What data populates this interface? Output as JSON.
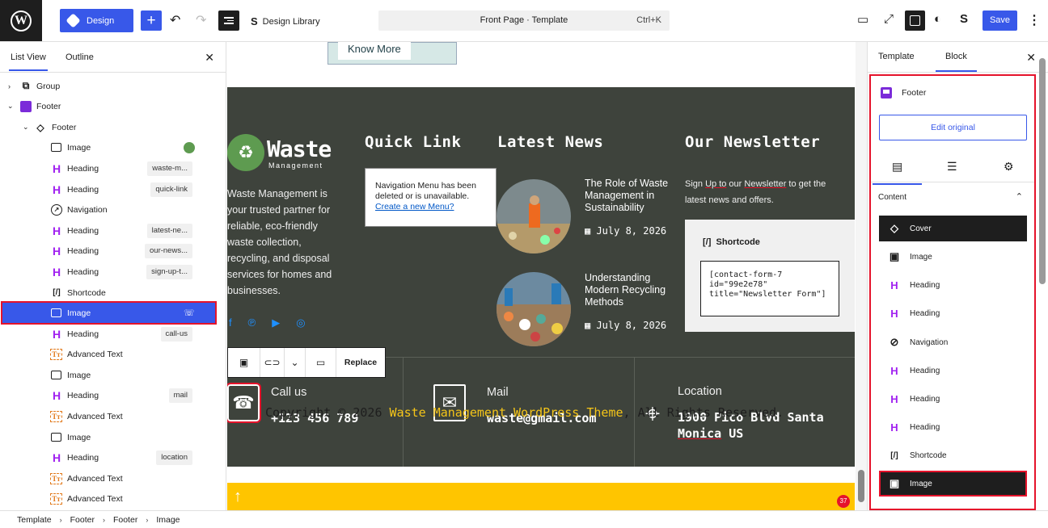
{
  "topbar": {
    "design_label": "Design",
    "design_library_label": "Design Library",
    "command_title": "Front Page · Template",
    "command_shortcut": "Ctrl+K",
    "save_label": "Save"
  },
  "list_view": {
    "tab_list": "List View",
    "tab_outline": "Outline",
    "rows": [
      {
        "label": "Group",
        "tag": ""
      },
      {
        "label": "Footer",
        "tag": ""
      },
      {
        "label": "Footer",
        "tag": ""
      },
      {
        "label": "Image",
        "tag": ""
      },
      {
        "label": "Heading",
        "tag": "waste-m..."
      },
      {
        "label": "Heading",
        "tag": "quick-link"
      },
      {
        "label": "Navigation",
        "tag": ""
      },
      {
        "label": "Heading",
        "tag": "latest-ne..."
      },
      {
        "label": "Heading",
        "tag": "our-news..."
      },
      {
        "label": "Heading",
        "tag": "sign-up-t..."
      },
      {
        "label": "Shortcode",
        "tag": ""
      },
      {
        "label": "Image",
        "tag": ""
      },
      {
        "label": "Heading",
        "tag": "call-us"
      },
      {
        "label": "Advanced Text",
        "tag": ""
      },
      {
        "label": "Image",
        "tag": ""
      },
      {
        "label": "Heading",
        "tag": "mail"
      },
      {
        "label": "Advanced Text",
        "tag": ""
      },
      {
        "label": "Image",
        "tag": ""
      },
      {
        "label": "Heading",
        "tag": "location"
      },
      {
        "label": "Advanced Text",
        "tag": ""
      },
      {
        "label": "Advanced Text",
        "tag": ""
      }
    ]
  },
  "canvas": {
    "know_more": "Know More",
    "brand_name": "Waste",
    "brand_sub": "Management",
    "about": "Waste Management is your trusted partner for reliable, eco-friendly waste collection, recycling, and disposal services for homes and businesses.",
    "quick_link_title": "Quick Link",
    "nav_msg": "Navigation Menu has been deleted or is unavailable.",
    "nav_link": "Create a new Menu?",
    "latest_news_title": "Latest News",
    "news": [
      {
        "title": "The Role of Waste Management in Sustainability",
        "date": "July 8, 2026"
      },
      {
        "title": "Understanding Modern Recycling Methods",
        "date": "July 8, 2026"
      }
    ],
    "newsletter_title": "Our Newsletter",
    "newsletter_text_1": "Sign ",
    "newsletter_text_up": "Up to",
    "newsletter_text_2": " our ",
    "newsletter_text_nl": "Newsletter",
    "newsletter_text_3": " to get the latest news and offers.",
    "shortcode_label": "Shortcode",
    "shortcode_code": "[contact-form-7 id=\"99e2e78\" title=\"Newsletter Form\"]",
    "toolbar_replace": "Replace",
    "call_label": "Call us",
    "call_value": "+123 456 789",
    "mail_label": "Mail",
    "mail_value": "waste@gmail.com",
    "location_label": "Location",
    "location_value_1": "1900 Pico Blvd Santa",
    "location_value_2a": "Monica",
    "location_value_2b": " US",
    "copyright_1": "Copyright © 2026 ",
    "copyright_hl": "Waste Management WordPress Theme",
    "copyright_2": ", All Rights Reserved.",
    "badge": "37"
  },
  "inspector": {
    "tab_template": "Template",
    "tab_block": "Block",
    "block_name": "Footer",
    "edit_original": "Edit original",
    "content_heading": "Content",
    "blocks": [
      {
        "label": "Cover",
        "icon": "cover-icon"
      },
      {
        "label": "Image",
        "icon": "image-icon"
      },
      {
        "label": "Heading",
        "icon": "heading-icon"
      },
      {
        "label": "Heading",
        "icon": "heading-icon"
      },
      {
        "label": "Navigation",
        "icon": "navigation-icon"
      },
      {
        "label": "Heading",
        "icon": "heading-icon"
      },
      {
        "label": "Heading",
        "icon": "heading-icon"
      },
      {
        "label": "Heading",
        "icon": "heading-icon"
      },
      {
        "label": "Shortcode",
        "icon": "shortcode-icon"
      },
      {
        "label": "Image",
        "icon": "image-icon"
      }
    ]
  },
  "breadcrumb": [
    "Template",
    "Footer",
    "Footer",
    "Image"
  ]
}
